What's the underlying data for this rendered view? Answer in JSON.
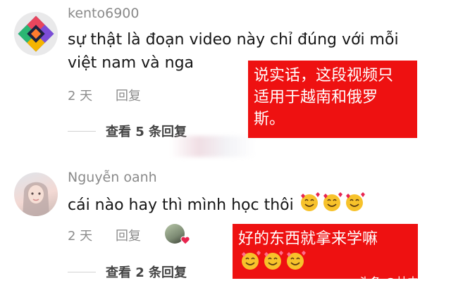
{
  "comments": [
    {
      "username": "kento6900",
      "text_line1": "sự thật là đoạn video này chỉ đúng với mỗi",
      "text_line2": "việt nam và nga",
      "time": "2 天",
      "reply_label": "回复",
      "view_replies": "查看 5 条回复"
    },
    {
      "username": "Nguyễn oanh",
      "text": "cái nào hay thì mình học thôi",
      "time": "2 天",
      "reply_label": "回复",
      "view_replies": "查看 2 条回复"
    }
  ],
  "annotations": [
    {
      "line1": "说实话，这段视频只",
      "line2": "适用于越南和俄罗",
      "line3": "斯。"
    },
    {
      "line1": "好的东西就拿来学嘛"
    }
  ],
  "watermark": {
    "text": "头条 @林中青衫"
  },
  "colors": {
    "annotation_bg": "#ee1111",
    "heart": "#e8244f"
  },
  "icons": [
    "geometric-avatar-icon",
    "smiling-hearts-emoji",
    "heart-icon"
  ]
}
